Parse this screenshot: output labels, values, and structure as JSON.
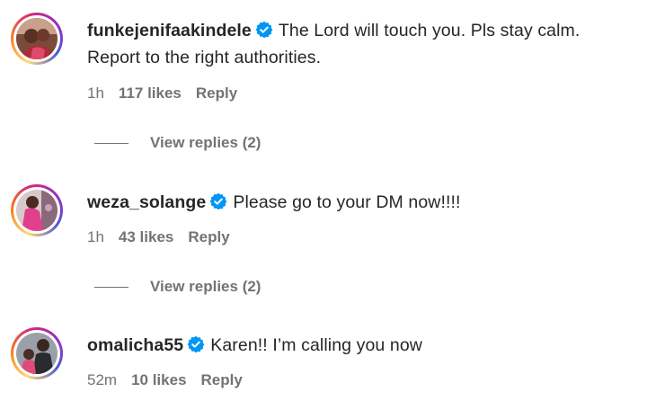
{
  "comments": [
    {
      "username": "funkejenifaakindele",
      "text": "The Lord will touch you. Pls stay calm. Report to the right authorities.",
      "time": "1h",
      "likes": "117 likes",
      "reply": "Reply",
      "view_replies": "View replies (2)",
      "avatar_icon": "profile-photo-icon"
    },
    {
      "username": "weza_solange",
      "text": "Please go to your DM now!!!!",
      "time": "1h",
      "likes": "43 likes",
      "reply": "Reply",
      "view_replies": "View replies (2)",
      "avatar_icon": "profile-photo-icon"
    },
    {
      "username": "omalicha55",
      "text": "Karen!! I’m calling you now",
      "time": "52m",
      "likes": "10 likes",
      "reply": "Reply",
      "avatar_icon": "profile-photo-icon"
    }
  ],
  "colors": {
    "verified_badge": "#0095f6",
    "meta_text": "#737373",
    "primary_text": "#262626"
  }
}
